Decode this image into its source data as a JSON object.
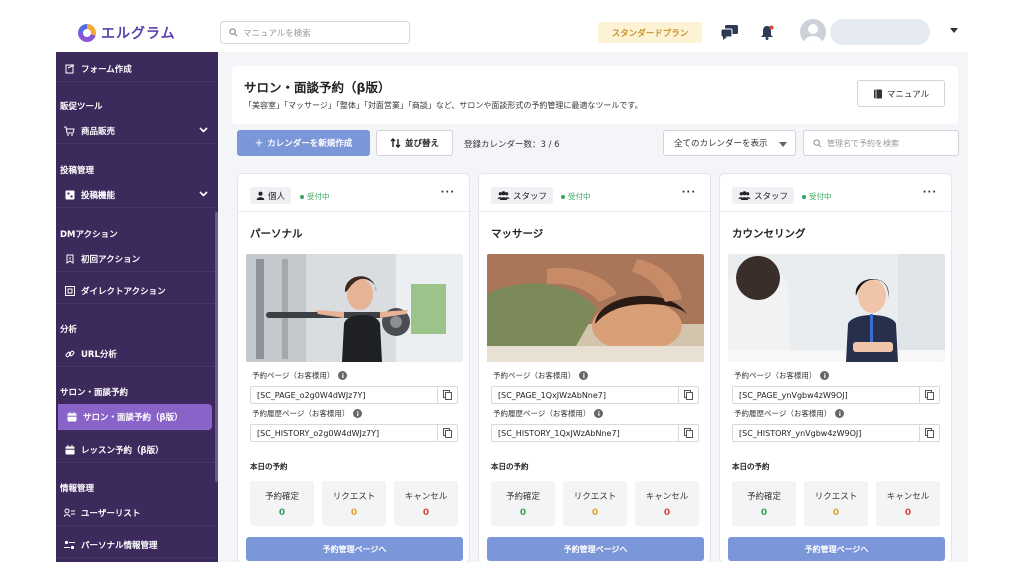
{
  "header": {
    "logo_text": "エルグラム",
    "search_placeholder": "マニュアルを検索",
    "plan_label": "スタンダードプラン",
    "icons": [
      "chat-icon",
      "bell-icon",
      "avatar",
      "chevron-down-icon"
    ]
  },
  "sidebar": {
    "items": [
      {
        "type": "item",
        "label": "フォーム作成",
        "icon": "form-icon"
      },
      {
        "type": "section",
        "label": "販促ツール"
      },
      {
        "type": "item",
        "label": "商品販売",
        "icon": "cart-icon",
        "chevron": true
      },
      {
        "type": "section",
        "label": "投稿管理"
      },
      {
        "type": "item",
        "label": "投稿機能",
        "icon": "post-icon",
        "chevron": true
      },
      {
        "type": "section",
        "label": "DMアクション"
      },
      {
        "type": "item",
        "label": "初回アクション",
        "icon": "first-action-icon"
      },
      {
        "type": "item",
        "label": "ダイレクトアクション",
        "icon": "direct-action-icon"
      },
      {
        "type": "section",
        "label": "分析"
      },
      {
        "type": "item",
        "label": "URL分析",
        "icon": "link-icon"
      },
      {
        "type": "section",
        "label": "サロン・面談予約"
      },
      {
        "type": "item",
        "label": "サロン・面談予約（β版）",
        "icon": "calendar-icon",
        "active": true
      },
      {
        "type": "item",
        "label": "レッスン予約（β版）",
        "icon": "calendar-icon"
      },
      {
        "type": "section",
        "label": "情報管理"
      },
      {
        "type": "item",
        "label": "ユーザーリスト",
        "icon": "user-list-icon"
      },
      {
        "type": "item",
        "label": "パーソナル情報管理",
        "icon": "personal-info-icon"
      }
    ]
  },
  "main": {
    "title": "サロン・面談予約（β版）",
    "description": "「美容室」「マッサージ」「整体」「対面営業」「商談」など、サロンや面談形式の予約管理に最適なツールです。",
    "manual_label": "マニュアル",
    "create_label": "カレンダーを新規作成",
    "sort_label": "並び替え",
    "count_text": "登録カレンダー数：3 / 6",
    "filter_value": "全てのカレンダーを表示",
    "search_placeholder": "管理名で予約を検索"
  },
  "cards_common": {
    "reserve_page_label": "予約ページ（お客様用）",
    "history_page_label": "予約履歴ページ（お客様用）",
    "today_label": "本日の予約",
    "stat_confirmed_label": "予約確定",
    "stat_request_label": "リクエスト",
    "stat_cancel_label": "キャンセル",
    "button_label": "予約管理ページへ",
    "stat_colors": {
      "confirmed": "#36a35a",
      "request": "#e0a32b",
      "cancel": "#d9473c"
    }
  },
  "cards": [
    {
      "badge": "個人",
      "badge_icon": "person-icon",
      "status": "受付中",
      "title": "パーソナル",
      "image": "gym-woman-photo",
      "reserve_code": "[SC_PAGE_o2g0W4dWJz7Y]",
      "history_code": "[SC_HISTORY_o2g0W4dWJz7Y]",
      "confirmed": "0",
      "request": "0",
      "cancel": "0"
    },
    {
      "badge": "スタッフ",
      "badge_icon": "staff-icon",
      "status": "受付中",
      "title": "マッサージ",
      "image": "massage-photo",
      "reserve_code": "[SC_PAGE_1QxJWzAbNne7]",
      "history_code": "[SC_HISTORY_1QxJWzAbNne7]",
      "confirmed": "0",
      "request": "0",
      "cancel": "0"
    },
    {
      "badge": "スタッフ",
      "badge_icon": "staff-icon",
      "status": "受付中",
      "title": "カウンセリング",
      "image": "counseling-photo",
      "reserve_code": "[SC_PAGE_ynVgbw4zW9OJ]",
      "history_code": "[SC_HISTORY_ynVgbw4zW9OJ]",
      "confirmed": "0",
      "request": "0",
      "cancel": "0"
    }
  ],
  "colors": {
    "sidebar_bg": "#3d2a5c",
    "sidebar_active": "#8a63c9",
    "primary_button": "#7b96d9",
    "plan_badge_bg": "#fdf2d4",
    "plan_badge_text": "#c8922a"
  }
}
